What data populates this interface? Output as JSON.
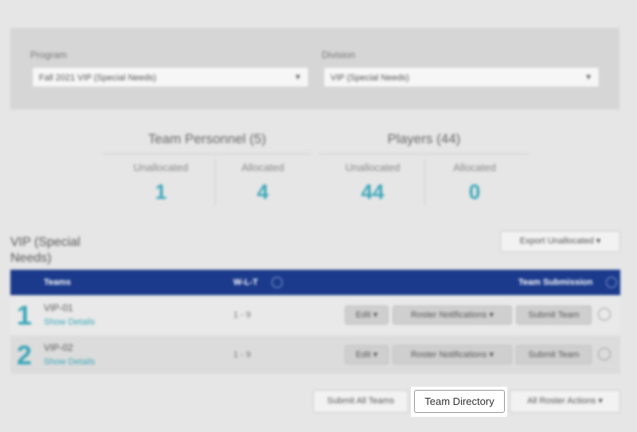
{
  "filters": {
    "program_label": "Program",
    "program_value": "Fall 2021 VIP (Special Needs)",
    "division_label": "Division",
    "division_value": "VIP (Special Needs)"
  },
  "stats": {
    "personnel": {
      "title": "Team Personnel (5)",
      "unallocated_label": "Unallocated",
      "unallocated_value": "1",
      "allocated_label": "Allocated",
      "allocated_value": "4"
    },
    "players": {
      "title": "Players (44)",
      "unallocated_label": "Unallocated",
      "unallocated_value": "44",
      "allocated_label": "Allocated",
      "allocated_value": "0"
    }
  },
  "section": {
    "title": "VIP (Special Needs)",
    "export_button": "Export Unallocated ▾"
  },
  "table": {
    "headers": {
      "teams": "Teams",
      "record": "W-L-T",
      "submission": "Team Submission"
    },
    "rows": [
      {
        "num": "1",
        "name": "VIP-01",
        "link": "Show Details",
        "record": "1 - 9",
        "edit": "Edit ▾",
        "roster": "Roster Notifications ▾",
        "submit": "Submit Team"
      },
      {
        "num": "2",
        "name": "VIP-02",
        "link": "Show Details",
        "record": "1 - 9",
        "edit": "Edit ▾",
        "roster": "Roster Notifications ▾",
        "submit": "Submit Team"
      }
    ]
  },
  "footer": {
    "submit_all": "Submit All Teams",
    "team_directory": "Team Directory",
    "all_roster_actions": "All Roster Actions ▾"
  },
  "colors": {
    "header_bg": "#1b3a8c",
    "accent": "#3aa6b9"
  }
}
